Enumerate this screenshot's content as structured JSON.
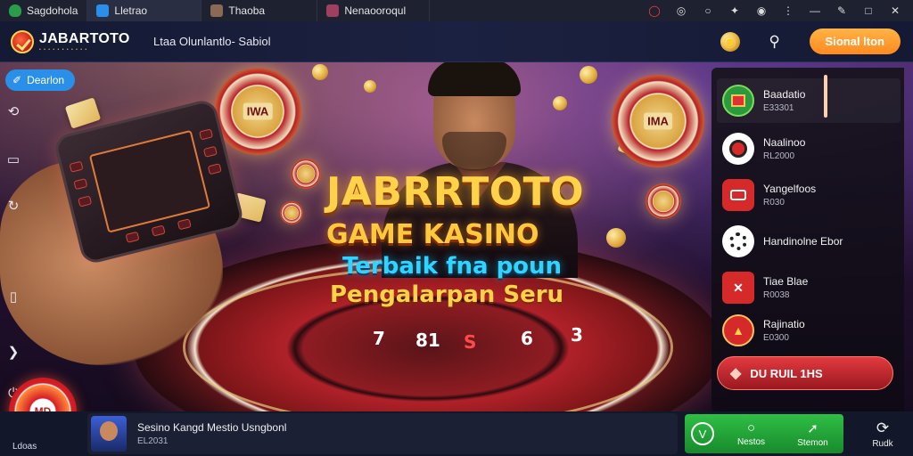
{
  "browser": {
    "tabs": [
      {
        "label": "Sagdohola",
        "icon": "shield-icon",
        "color": "#2a9d4b",
        "active": false
      },
      {
        "label": "Lletrao",
        "icon": "chat-icon",
        "color": "#2a8fe8",
        "active": true
      },
      {
        "label": "Thaoba",
        "icon": "thumbnail-icon",
        "color": "#8a6a55",
        "active": false
      },
      {
        "label": "Nenaooroqul",
        "icon": "thumbnail-icon",
        "color": "#a04060",
        "active": false
      }
    ],
    "controls": [
      "opera-icon",
      "cast-icon",
      "chat-icon",
      "puzzle-icon",
      "download-icon",
      "menu-icon",
      "minimize-icon",
      "edit-icon",
      "maximize-icon",
      "close-icon"
    ]
  },
  "header": {
    "logo_text": "JABARTOTO",
    "logo_subtext": "• • • • • • • • • • •",
    "title": "Ltaa Olunlantlo- Sabiol",
    "icons": [
      "coin-icon",
      "settings-icon",
      "search-icon"
    ],
    "cta_label": "Sional lton",
    "accent": "#ff8a1f"
  },
  "hero": {
    "title_line1": "JABRRTOTO",
    "title_line2": "GAME KASINO",
    "title_line3": "Terbaik fna poun",
    "title_line4": "Pengalarpan Seru",
    "wheel_numbers": [
      "7",
      "81",
      "S",
      "6",
      "3"
    ],
    "chip_left_mark": "IWA",
    "chip_right_mark": "IMA"
  },
  "left_controls": {
    "pill_label": "Dearlon",
    "icons": [
      "history-icon",
      "layers-icon",
      "refresh-icon",
      "phone-icon",
      "share-icon",
      "power-icon"
    ],
    "corner_chip_mark": "MD",
    "corner_label": "Ldoas"
  },
  "game_list": {
    "items": [
      {
        "name": "Baadatio",
        "sub": "E33301",
        "icon": "slot-machine-icon",
        "color": "#2b9a3c",
        "active": true
      },
      {
        "name": "Naalinoo",
        "sub": "RL2000",
        "icon": "roulette-icon",
        "color": "#ffffff",
        "active": false
      },
      {
        "name": "Yangelfoos",
        "sub": "R030",
        "icon": "wallet-icon",
        "color": "#d62a2a",
        "active": false
      },
      {
        "name": "Handinolne Ebor",
        "sub": "",
        "icon": "chip-icon",
        "color": "#ffffff",
        "active": false
      },
      {
        "name": "Tiae Blae",
        "sub": "R0038",
        "icon": "envelope-icon",
        "color": "#d62a2a",
        "active": false
      },
      {
        "name": "Rajinatio",
        "sub": "E0300",
        "icon": "fire-badge-icon",
        "color": "#d62a2a",
        "active": false
      }
    ],
    "play_button_label": "DU RUIL 1HS"
  },
  "bottom_bar": {
    "now_playing_title": "Sesino Kangd Mestio Usngbonl",
    "now_playing_sub": "EL2031",
    "actions": [
      {
        "label": "",
        "icon": "v-logo-icon"
      },
      {
        "label": "Nestos",
        "icon": "info-icon"
      },
      {
        "label": "Stemon",
        "icon": "trend-icon"
      }
    ],
    "refresh_label": "Rudk",
    "refresh_icon": "refresh-icon"
  }
}
